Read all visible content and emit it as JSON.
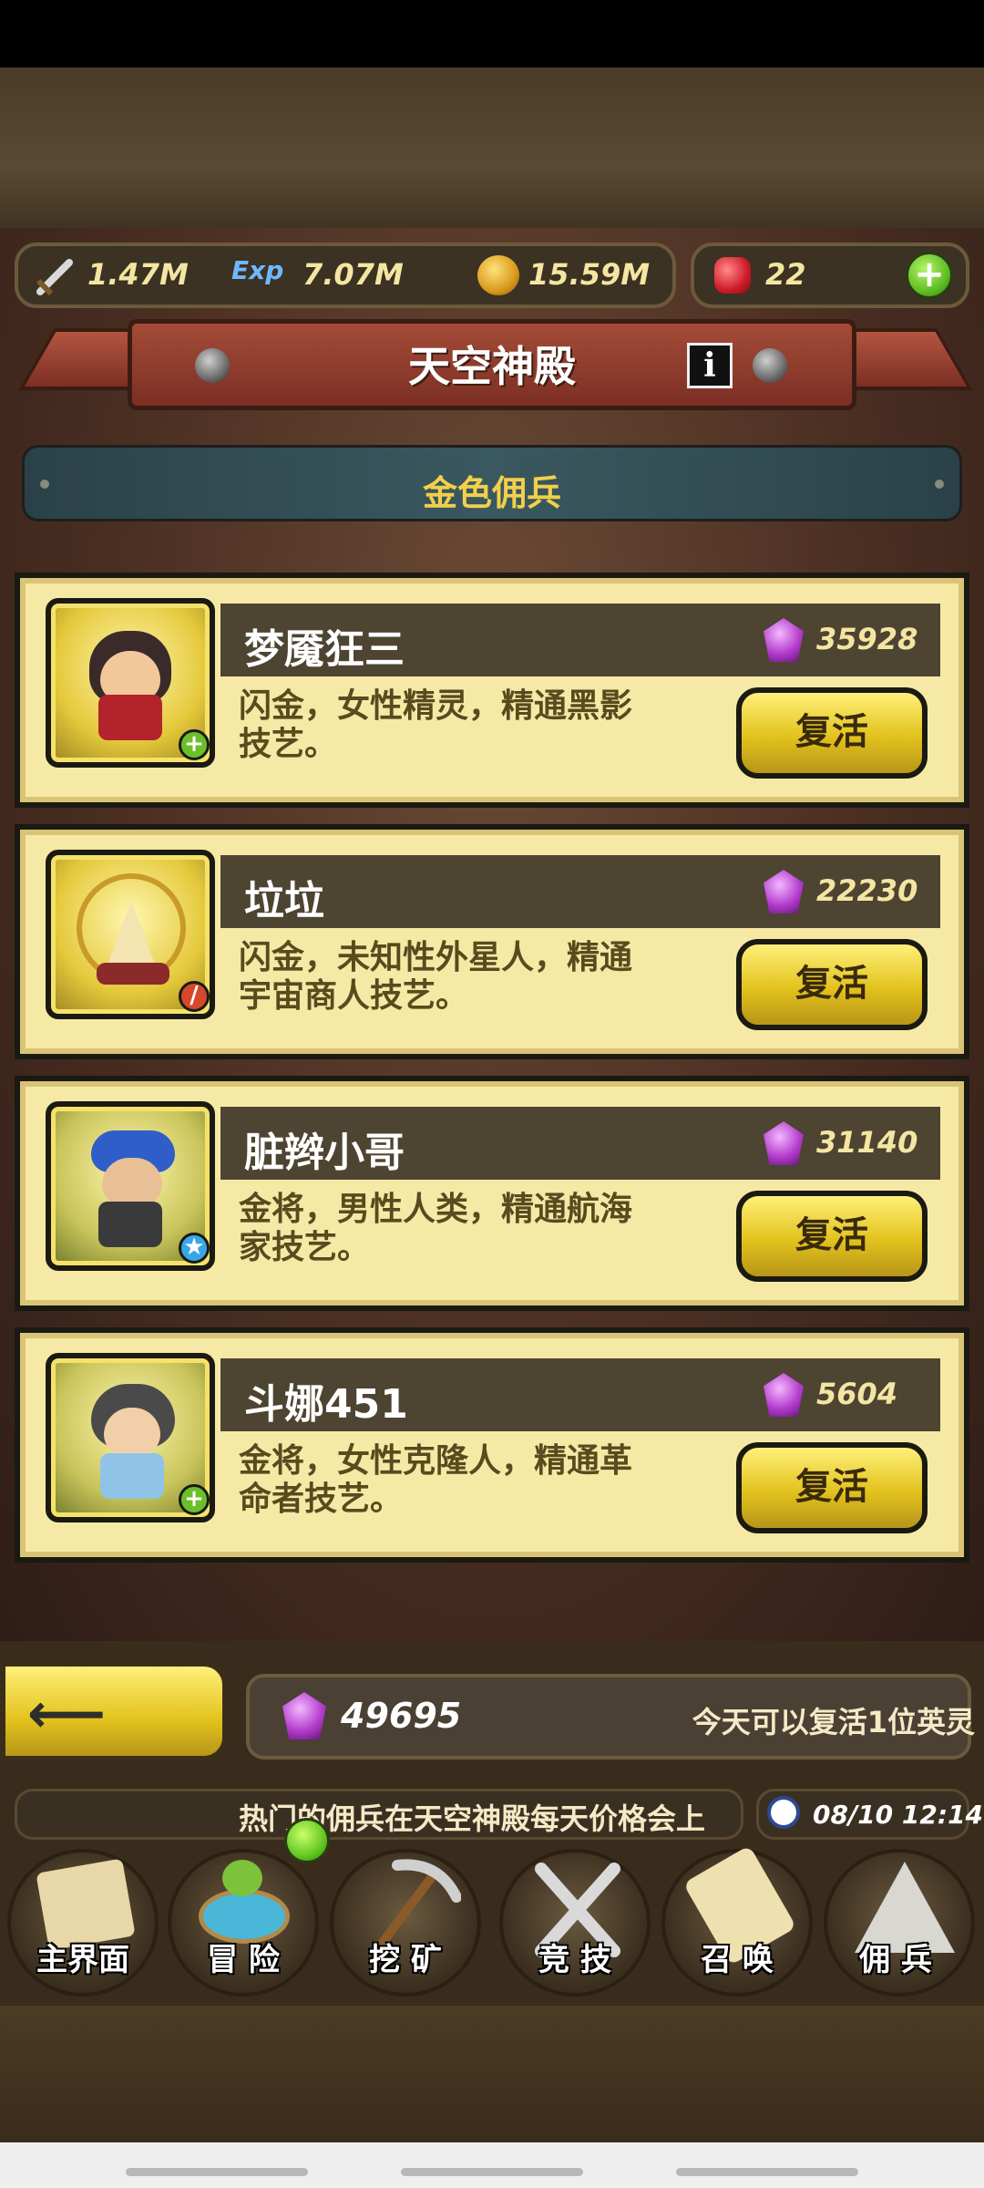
{
  "resources": {
    "attack": "1.47M",
    "exp_label": "Exp",
    "exp": "7.07M",
    "gold": "15.59M",
    "ruby": "22"
  },
  "header": {
    "title": "天空神殿",
    "info_label": "i",
    "subtitle": "金色佣兵"
  },
  "mercenaries": [
    {
      "name": "梦魇狂三",
      "price": "35928",
      "desc_line1": "闪金，女性精灵，精通黑影",
      "desc_line2": "技艺。",
      "revive": "复活",
      "badge_icon": "plus-badge-icon"
    },
    {
      "name": "垃垃",
      "price": "22230",
      "desc_line1": "闪金，未知性外星人，精通",
      "desc_line2": "宇宙商人技艺。",
      "revive": "复活",
      "badge_icon": "sword-badge-icon"
    },
    {
      "name": "脏辫小哥",
      "price": "31140",
      "desc_line1": "金将，男性人类，精通航海",
      "desc_line2": "家技艺。",
      "revive": "复活",
      "badge_icon": "star-badge-icon"
    },
    {
      "name": "斗娜451",
      "price": "5604",
      "desc_line1": "金将，女性克隆人，精通革",
      "desc_line2": "命者技艺。",
      "revive": "复活",
      "badge_icon": "plus-badge-icon"
    }
  ],
  "footer": {
    "gem_total": "49695",
    "revive_note": "今天可以复活1位英灵",
    "ticker": "热门的佣兵在天空神殿每天价格会上",
    "datetime": "08/10 12:14"
  },
  "tabs": [
    {
      "label": "主界面",
      "icon": "map-scroll-icon"
    },
    {
      "label": "冒 险",
      "icon": "island-icon"
    },
    {
      "label": "挖 矿",
      "icon": "pickaxe-icon"
    },
    {
      "label": "竞 技",
      "icon": "crossed-swords-icon"
    },
    {
      "label": "召 唤",
      "icon": "summon-scroll-icon"
    },
    {
      "label": "佣 兵",
      "icon": "tent-icon"
    }
  ],
  "colors": {
    "accent_gold": "#e2c21c",
    "banner_red": "#7c2f24",
    "card_bg": "#f6e9a6",
    "text_gold": "#f2d04a"
  }
}
